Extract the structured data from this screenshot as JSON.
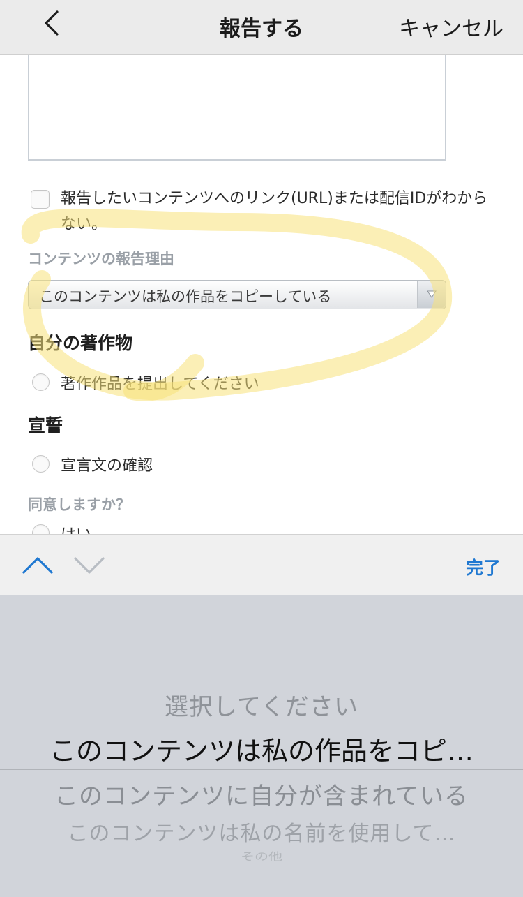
{
  "navbar": {
    "title": "報告する",
    "cancel_label": "キャンセル",
    "back_icon": "chevron-left-icon"
  },
  "form": {
    "url_unknown_checkbox": {
      "checked": false,
      "label": "報告したいコンテンツへのリンク(URL)または配信IDがわからない。"
    },
    "reason_label": "コンテンツの報告理由",
    "reason_select": {
      "value": "このコンテンツは私の作品をコピーしている",
      "arrow_icon": "triangle-down-icon"
    },
    "own_work": {
      "heading": "自分の著作物",
      "option_label": "著作作品を提出してください"
    },
    "oath": {
      "heading": "宣誓",
      "option_label": "宣言文の確認"
    },
    "agree": {
      "label": "同意しますか？",
      "option_yes": "はい"
    }
  },
  "highlight_color": "#f7e27a",
  "toolbar": {
    "prev_icon": "chevron-up-icon",
    "next_icon": "chevron-down-icon",
    "done_label": "完了",
    "accent_color": "#1f78d1"
  },
  "picker": {
    "options": [
      "選択してください",
      "このコンテンツは私の作品をコピ…",
      "このコンテンツに自分が含まれている",
      "このコンテンツは私の名前を使用して…",
      "その他"
    ],
    "selected_index": 1
  }
}
